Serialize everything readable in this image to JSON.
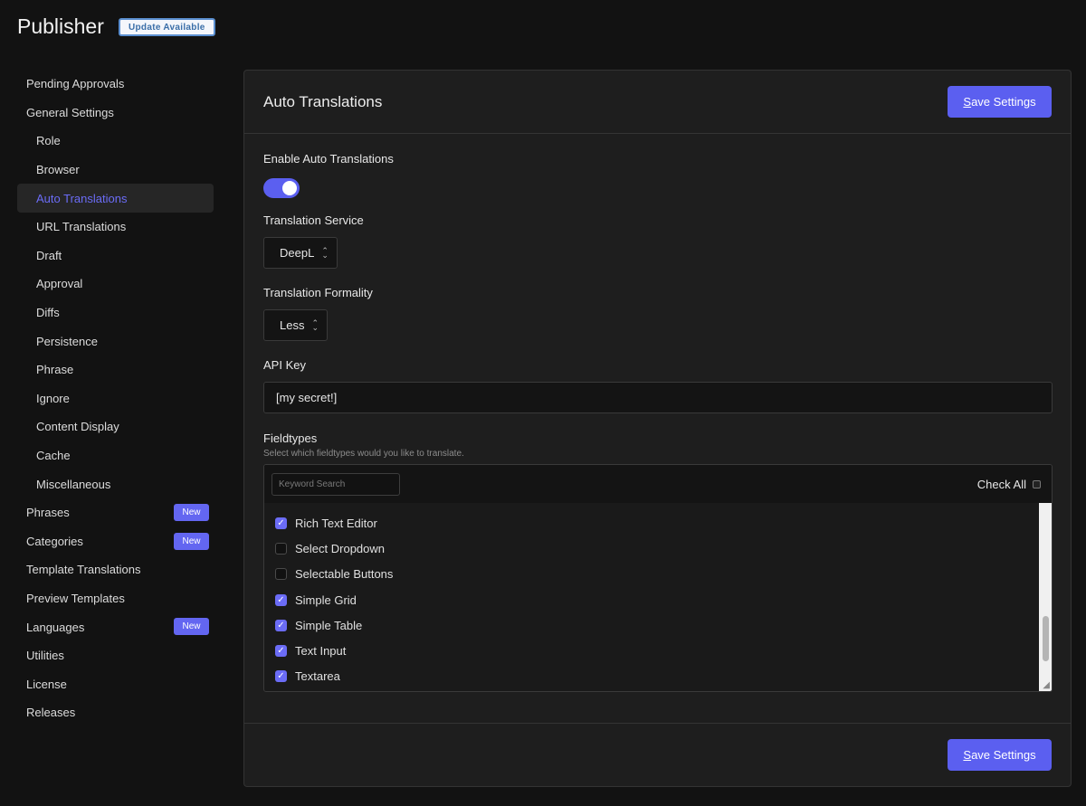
{
  "app": {
    "title": "Publisher",
    "update_badge": "Update Available"
  },
  "sidebar": {
    "items": [
      {
        "label": "Pending Approvals",
        "level": 0
      },
      {
        "label": "General Settings",
        "level": 0
      },
      {
        "label": "Role",
        "level": 1
      },
      {
        "label": "Browser",
        "level": 1
      },
      {
        "label": "Auto Translations",
        "level": 1,
        "active": true
      },
      {
        "label": "URL Translations",
        "level": 1
      },
      {
        "label": "Draft",
        "level": 1
      },
      {
        "label": "Approval",
        "level": 1
      },
      {
        "label": "Diffs",
        "level": 1
      },
      {
        "label": "Persistence",
        "level": 1
      },
      {
        "label": "Phrase",
        "level": 1
      },
      {
        "label": "Ignore",
        "level": 1
      },
      {
        "label": "Content Display",
        "level": 1
      },
      {
        "label": "Cache",
        "level": 1
      },
      {
        "label": "Miscellaneous",
        "level": 1
      },
      {
        "label": "Phrases",
        "level": 0,
        "badge": "New"
      },
      {
        "label": "Categories",
        "level": 0,
        "badge": "New"
      },
      {
        "label": "Template Translations",
        "level": 0
      },
      {
        "label": "Preview Templates",
        "level": 0
      },
      {
        "label": "Languages",
        "level": 0,
        "badge": "New"
      },
      {
        "label": "Utilities",
        "level": 0
      },
      {
        "label": "License",
        "level": 0
      },
      {
        "label": "Releases",
        "level": 0
      }
    ]
  },
  "panel": {
    "title": "Auto Translations",
    "save_label_first": "S",
    "save_label_rest": "ave Settings"
  },
  "form": {
    "enable_label": "Enable Auto Translations",
    "enable_value": true,
    "service_label": "Translation Service",
    "service_value": "DeepL",
    "formality_label": "Translation Formality",
    "formality_value": "Less",
    "api_key_label": "API Key",
    "api_key_value": "[my secret!]",
    "fieldtypes_label": "Fieldtypes",
    "fieldtypes_hint": "Select which fieldtypes would you like to translate.",
    "keyword_placeholder": "Keyword Search",
    "check_all_label": "Check All",
    "fieldtypes": [
      {
        "label": "Rich Text Editor",
        "checked": true
      },
      {
        "label": "Select Dropdown",
        "checked": false
      },
      {
        "label": "Selectable Buttons",
        "checked": false
      },
      {
        "label": "Simple Grid",
        "checked": true
      },
      {
        "label": "Simple Table",
        "checked": true
      },
      {
        "label": "Text Input",
        "checked": true
      },
      {
        "label": "Textarea",
        "checked": true
      }
    ]
  },
  "colors": {
    "accent": "#5b5ff0",
    "background": "#121212",
    "panel": "#1e1e1e"
  }
}
